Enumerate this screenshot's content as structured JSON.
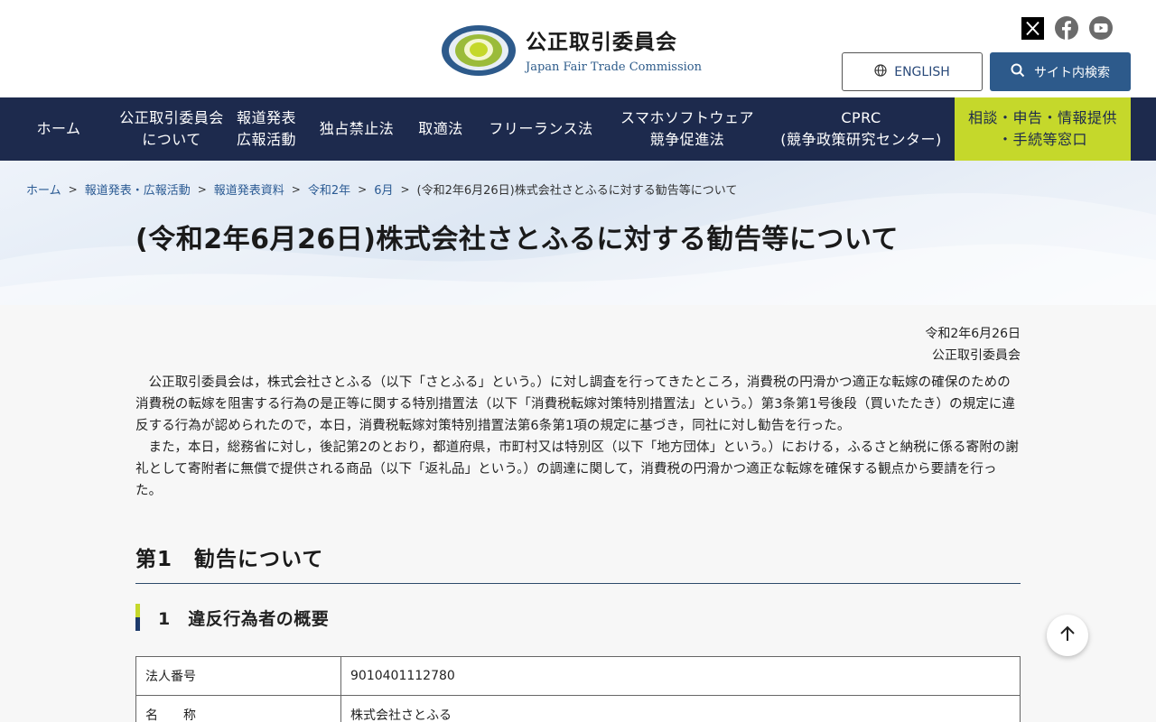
{
  "header": {
    "site_title": "公正取引委員会",
    "site_subtitle": "Japan Fair Trade Commission",
    "english_label": "ENGLISH",
    "search_label": "サイト内検索",
    "sns": [
      "x-icon",
      "facebook-icon",
      "youtube-icon"
    ]
  },
  "nav": {
    "items": [
      {
        "label": "ホーム"
      },
      {
        "label": "公正取引委員会\nについて"
      },
      {
        "label": "報道発表\n広報活動"
      },
      {
        "label": "独占禁止法"
      },
      {
        "label": "取適法"
      },
      {
        "label": "フリーランス法"
      },
      {
        "label": "スマホソフトウェア\n競争促進法"
      },
      {
        "label": "CPRC\n(競争政策研究センター)"
      },
      {
        "label": "相談・申告・情報提供\n・手続等窓口"
      }
    ]
  },
  "breadcrumb": {
    "items": [
      "ホーム",
      "報道発表・広報活動",
      "報道発表資料",
      "令和2年",
      "6月"
    ],
    "current": "(令和2年6月26日)株式会社さとふるに対する勧告等について"
  },
  "page": {
    "title": "(令和2年6月26日)株式会社さとふるに対する勧告等について",
    "date": "令和2年6月26日",
    "issuer": "公正取引委員会",
    "paragraph1": "公正取引委員会は，株式会社さとふる（以下「さとふる」という。）に対し調査を行ってきたところ，消費税の円滑かつ適正な転嫁の確保のための消費税の転嫁を阻害する行為の是正等に関する特別措置法（以下「消費税転嫁対策特別措置法」という。）第3条第1号後段（買いたたき）の規定に違反する行為が認められたので，本日，消費税転嫁対策特別措置法第6条第1項の規定に基づき，同社に対し勧告を行った。",
    "paragraph2": "また，本日，総務省に対し，後記第2のとおり，都道府県，市町村又は特別区（以下「地方団体」という。）における，ふるさと納税に係る寄附の謝礼として寄附者に無償で提供される商品（以下「返礼品」という。）の調達に関して，消費税の円滑かつ適正な転嫁を確保する観点から要請を行った。",
    "section1_heading": "第1　勧告について",
    "subsection1_heading": "1　違反行為者の概要",
    "table": [
      {
        "label": "法人番号",
        "value": "9010401112780"
      },
      {
        "label": "名　　称",
        "value": "株式会社さとふる"
      }
    ]
  },
  "colors": {
    "nav_bg": "#1d2a4d",
    "accent_green": "#c5d82b",
    "brand_blue": "#2d5a8b"
  }
}
